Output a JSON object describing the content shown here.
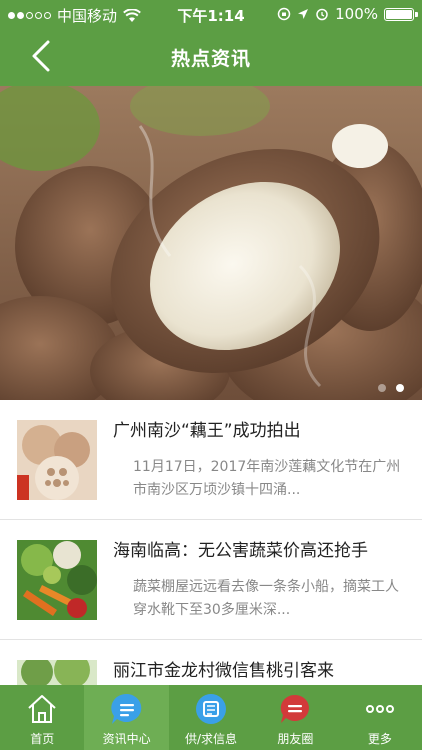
{
  "status_bar": {
    "carrier": "中国移动",
    "time": "下午1:14",
    "battery": "100%"
  },
  "header": {
    "title": "热点资讯",
    "back_icon": "chevron-left-icon"
  },
  "banner": {
    "image": "taro-root-photo",
    "page_count": 2,
    "active_page": 2
  },
  "news": [
    {
      "title": "广州南沙“藕王”成功拍出",
      "summary": "11月17日，2017年南沙莲藕文化节在广州市南沙区万顷沙镇十四涌...",
      "thumb": "lotus-root-photo"
    },
    {
      "title": "海南临高：无公害蔬菜价高还抢手",
      "summary": "蔬菜棚屋远远看去像一条条小船，摘菜工人穿水靴下至30多厘米深...",
      "thumb": "vegetables-photo"
    },
    {
      "title": "丽江市金龙村微信售桃引客来",
      "summary": "",
      "thumb": "peach-orchard-photo"
    }
  ],
  "tabs": [
    {
      "label": "首页",
      "icon": "home-icon"
    },
    {
      "label": "资讯中心",
      "icon": "chat-bubble-icon"
    },
    {
      "label": "供/求信息",
      "icon": "supply-icon"
    },
    {
      "label": "朋友圈",
      "icon": "message-icon"
    },
    {
      "label": "更多",
      "icon": "more-dots-icon"
    }
  ],
  "colors": {
    "primary": "#5c9e44",
    "tab_active": "#6eae54",
    "title_text": "#222222",
    "summary_text": "#888888"
  }
}
